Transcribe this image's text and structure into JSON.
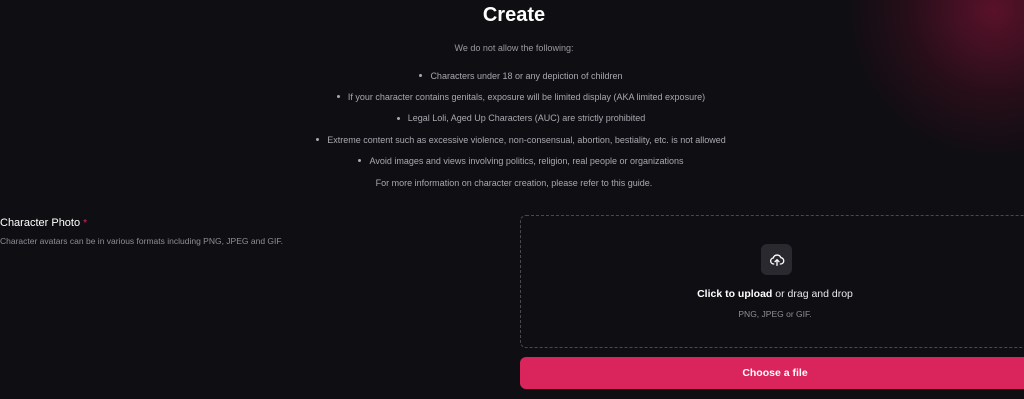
{
  "header": {
    "title": "Create"
  },
  "rules": {
    "intro": "We do not allow the following:",
    "items": [
      "Characters under 18 or any depiction of children",
      "If your character contains genitals, exposure will be limited display (AKA limited exposure)",
      "Legal Loli, Aged Up Characters (AUC) are strictly prohibited",
      "Extreme content such as excessive violence, non-consensual, abortion, bestiality, etc. is not allowed",
      "Avoid images and views involving politics, religion, real people or organizations"
    ],
    "more_info": "For more information on character creation, please refer to this guide."
  },
  "character_photo": {
    "label": "Character Photo",
    "required_mark": "*",
    "help": "Character avatars can be in various formats including PNG, JPEG and GIF."
  },
  "dropzone": {
    "icon": "upload-cloud-icon",
    "click_text": "Click to upload",
    "drag_text": " or drag and drop",
    "hint": "PNG, JPEG or GIF."
  },
  "choose_button": {
    "label": "Choose a file"
  },
  "colors": {
    "background": "#0f0e12",
    "accent": "#d9245c",
    "required": "#e0245e"
  }
}
